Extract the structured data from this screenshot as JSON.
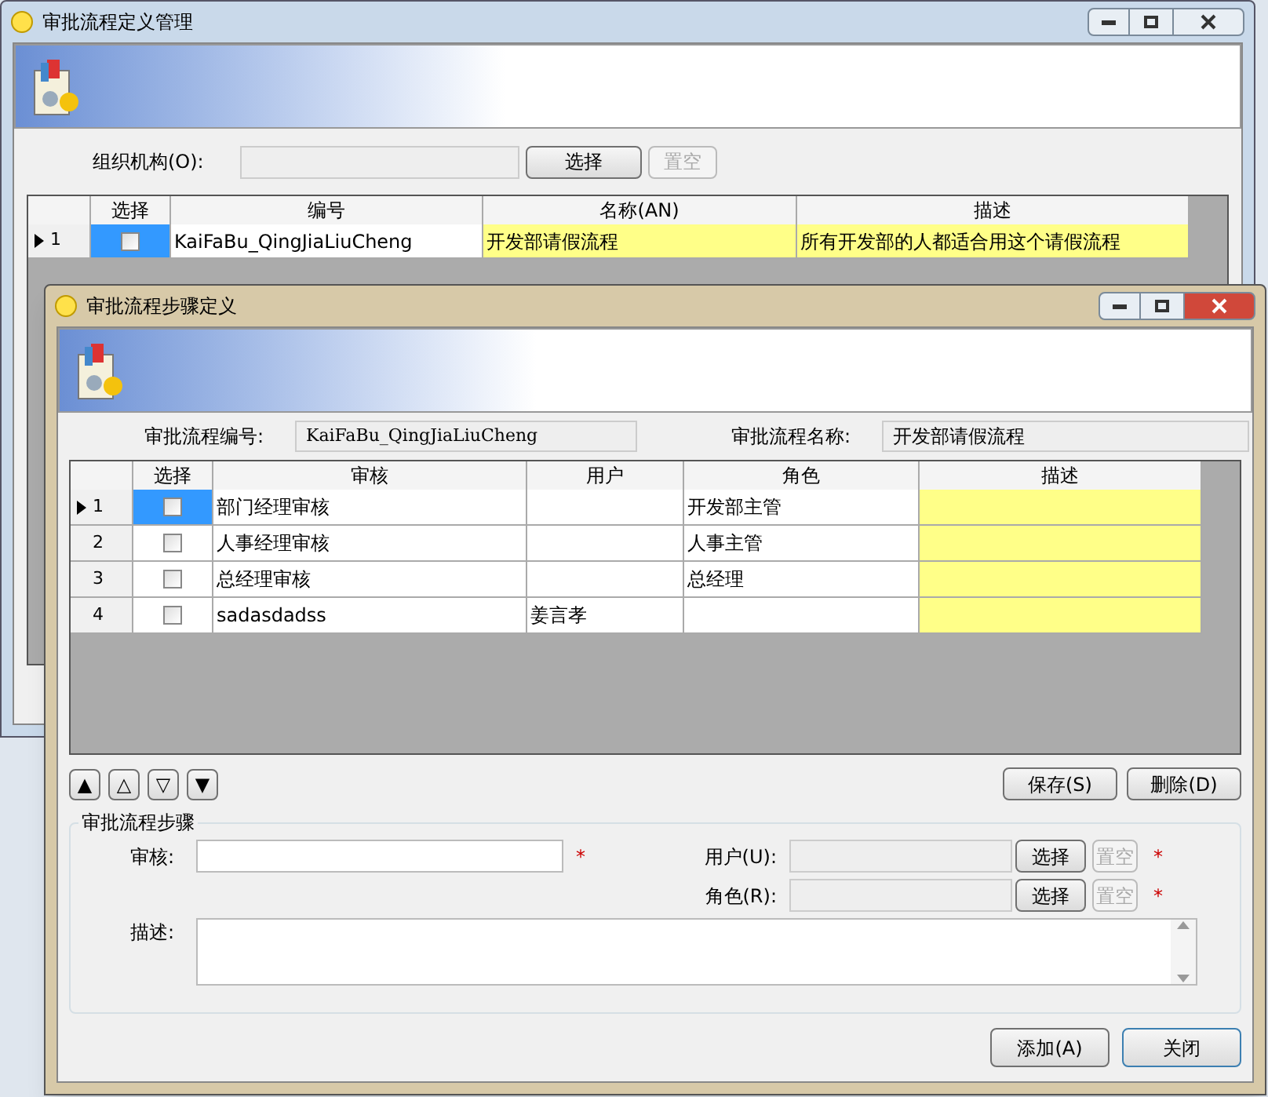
{
  "main_window": {
    "title": "审批流程定义管理",
    "org_label": "组织机构(O):",
    "buttons": [
      {
        "label": "选择",
        "disabled": false
      },
      {
        "label": "置空",
        "disabled": true
      }
    ],
    "grid": {
      "columns": [
        "选择",
        "编号",
        "名称(AN)",
        "描述"
      ],
      "rows": [
        {
          "number": "1",
          "current": true,
          "checked": false,
          "code": "KaiFaBu_QingJiaLiuCheng",
          "name": "开发部请假流程",
          "description": "所有开发部的人都适合用这个请假流程"
        }
      ]
    }
  },
  "step_window": {
    "title": "审批流程步骤定义",
    "code_label": "审批流程编号:",
    "code_value": "KaiFaBu_QingJiaLiuCheng",
    "name_label": "审批流程名称:",
    "name_value": "开发部请假流程",
    "grid": {
      "columns": [
        "选择",
        "审核",
        "用户",
        "角色",
        "描述"
      ],
      "rows": [
        {
          "number": "1",
          "current": true,
          "checked": false,
          "review": "部门经理审核",
          "role": "开发部主管"
        },
        {
          "number": "2",
          "current": false,
          "checked": false,
          "review": "人事经理审核",
          "role": "人事主管"
        },
        {
          "number": "3",
          "current": false,
          "checked": false,
          "review": "总经理审核",
          "role": "总经理"
        },
        {
          "number": "4",
          "current": false,
          "checked": false,
          "review": "sadasdadss",
          "user": "姜言孝"
        }
      ]
    },
    "move_buttons": [
      "▲",
      "△",
      "▽",
      "▼"
    ],
    "action_buttons": [
      "保存(S)",
      "删除(D)"
    ],
    "group": {
      "title": "审批流程步骤",
      "review_label": "审核:",
      "user_label": "用户(U):",
      "role_label": "角色(R):",
      "description_label": "描述:",
      "user_buttons": [
        {
          "label": "选择",
          "disabled": false
        },
        {
          "label": "置空",
          "disabled": true
        }
      ],
      "role_buttons": [
        {
          "label": "选择",
          "disabled": false
        },
        {
          "label": "置空",
          "disabled": true
        }
      ],
      "required_mark": "*"
    },
    "bottom_buttons": [
      "添加(A)",
      "关闭"
    ]
  }
}
